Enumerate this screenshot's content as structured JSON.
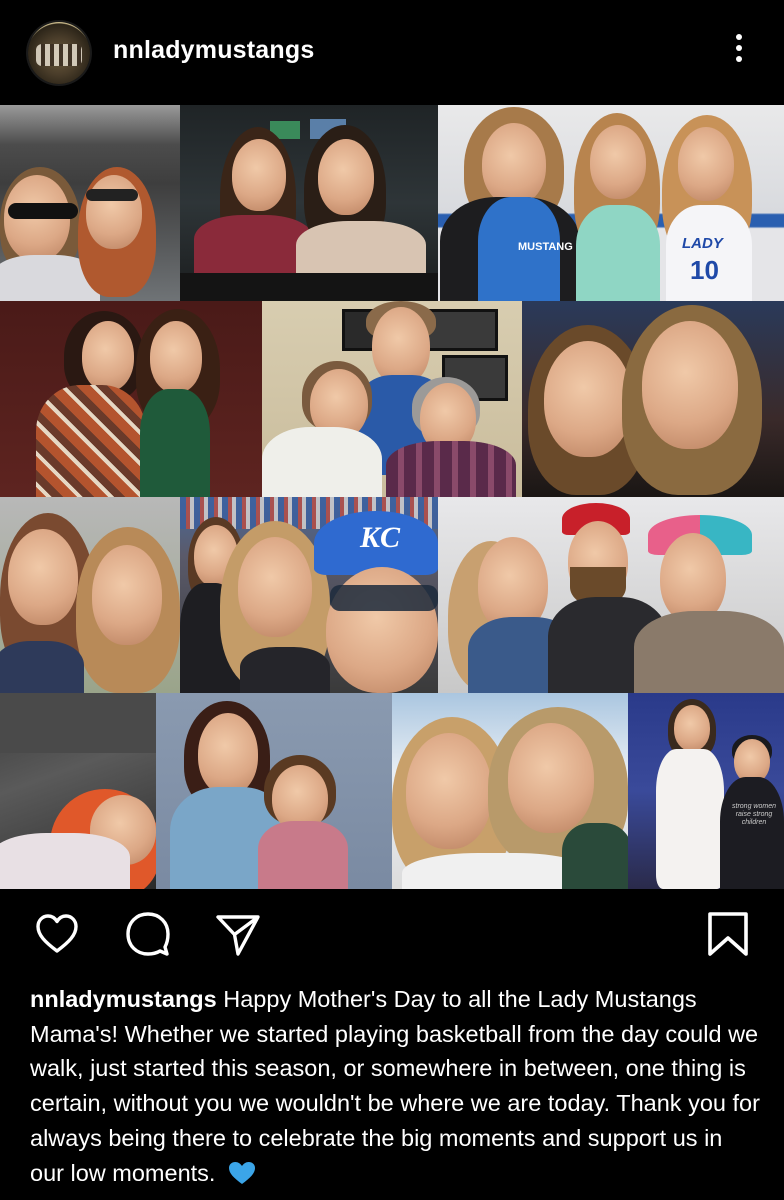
{
  "post": {
    "username": "nnladymustangs",
    "caption_user": "nnladymustangs",
    "caption_text": "Happy Mother's Day to all the Lady Mustangs Mama's! Whether we started playing basketball from the day could we walk, just started this season, or somewhere in between, one thing is certain, without you we wouldn't be where we are today. Thank you for always being there to celebrate the big moments and support us in our low moments.",
    "caption_emoji": "blue-heart-emoji"
  },
  "collage": {
    "tiles": [
      {
        "name": "photo-car-selfie"
      },
      {
        "name": "photo-restaurant-booth"
      },
      {
        "name": "photo-gym-three-people"
      },
      {
        "name": "photo-plaid-and-green-dress"
      },
      {
        "name": "photo-three-women-indoor"
      },
      {
        "name": "photo-dark-selfie"
      },
      {
        "name": "photo-outdoor-selfie"
      },
      {
        "name": "photo-stadium-kc-cap"
      },
      {
        "name": "photo-family-hats"
      },
      {
        "name": "photo-child-in-car"
      },
      {
        "name": "photo-vintage-mother-daughter"
      },
      {
        "name": "photo-beach-selfie"
      },
      {
        "name": "photo-prom-white-dress"
      }
    ],
    "texts": {
      "shirt_mustangs": "MUSTANG",
      "shirt_lady": "LADY",
      "jersey_number": "10",
      "cap_kc": "KC",
      "shirt_word": "strong women raise strong children"
    }
  },
  "actions": {
    "like": "heart-icon",
    "comment": "comment-icon",
    "share": "send-icon",
    "save": "bookmark-icon"
  },
  "colors": {
    "background": "#000000",
    "text": "#ffffff",
    "heart_emoji": "#3ba5e8"
  }
}
